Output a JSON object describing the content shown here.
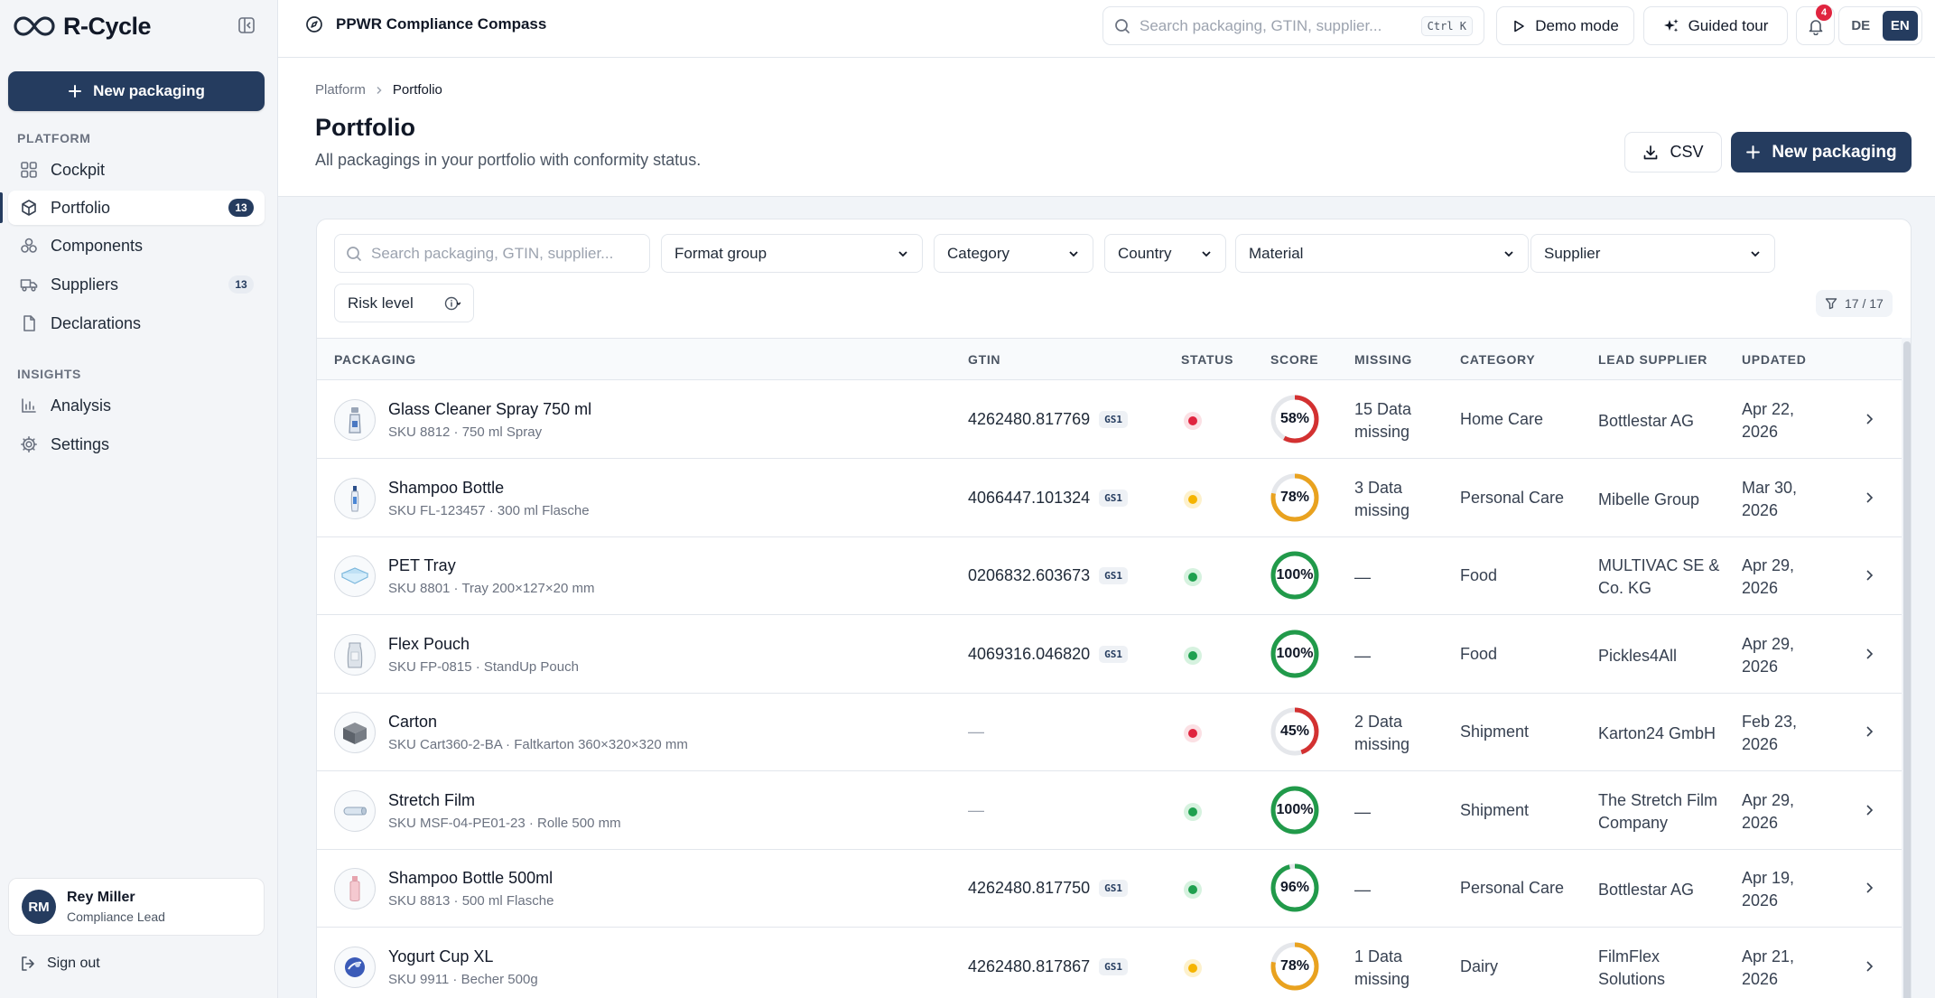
{
  "brand": {
    "name": "R-Cycle"
  },
  "sidebar": {
    "new_button": "New packaging",
    "sections": {
      "platform": "PLATFORM",
      "insights": "INSIGHTS"
    },
    "items": [
      {
        "label": "Cockpit",
        "icon": "grid-icon"
      },
      {
        "label": "Portfolio",
        "icon": "package-icon",
        "count": "13",
        "active": true
      },
      {
        "label": "Components",
        "icon": "components-icon"
      },
      {
        "label": "Suppliers",
        "icon": "truck-icon",
        "count": "13"
      },
      {
        "label": "Declarations",
        "icon": "document-icon"
      },
      {
        "label": "Analysis",
        "icon": "bar-chart-icon"
      },
      {
        "label": "Settings",
        "icon": "gear-icon"
      }
    ],
    "user": {
      "initials": "RM",
      "name": "Rey Miller",
      "role": "Compliance Lead"
    },
    "signout": "Sign out"
  },
  "topbar": {
    "title": "PPWR Compliance Compass",
    "search_placeholder": "Search packaging, GTIN, supplier...",
    "shortcut": "Ctrl K",
    "demo_mode": "Demo mode",
    "guided_tour": "Guided tour",
    "notifications": "4",
    "languages": [
      "DE",
      "EN"
    ],
    "active_language": "EN"
  },
  "page": {
    "breadcrumb": [
      "Platform",
      "Portfolio"
    ],
    "title": "Portfolio",
    "subtitle": "All packagings in your portfolio with conformity status.",
    "csv_button": "CSV",
    "new_button": "New packaging"
  },
  "filters": {
    "search_placeholder": "Search packaging, GTIN, supplier...",
    "format_group": "Format group",
    "category": "Category",
    "country": "Country",
    "material": "Material",
    "supplier": "Supplier",
    "risk_level": "Risk level",
    "result_count": "17 / 17"
  },
  "table": {
    "headers": [
      "PACKAGING",
      "GTIN",
      "STATUS",
      "SCORE",
      "MISSING",
      "CATEGORY",
      "LEAD SUPPLIER",
      "UPDATED"
    ],
    "rows": [
      {
        "name": "Glass Cleaner Spray 750 ml",
        "sku": "SKU 8812 · 750 ml Spray",
        "gtin": "4262480.817769",
        "gs1": "GS1",
        "status": "red",
        "score": 58,
        "score_label": "58%",
        "missing": "15 Data missing",
        "category": "Home Care",
        "supplier": "Bottlestar AG",
        "updated": "Apr 22, 2026",
        "thumb": "spray"
      },
      {
        "name": "Shampoo Bottle",
        "sku": "SKU FL-123457 · 300 ml Flasche",
        "gtin": "4066447.101324",
        "gs1": "GS1",
        "status": "yellow",
        "score": 78,
        "score_label": "78%",
        "missing": "3 Data missing",
        "category": "Personal Care",
        "supplier": "Mibelle Group",
        "updated": "Mar 30, 2026",
        "thumb": "bottle"
      },
      {
        "name": "PET Tray",
        "sku": "SKU 8801 · Tray 200×127×20 mm",
        "gtin": "0206832.603673",
        "gs1": "GS1",
        "status": "green",
        "score": 100,
        "score_label": "100%",
        "missing": "—",
        "category": "Food",
        "supplier": "MULTIVAC SE & Co. KG",
        "updated": "Apr 29, 2026",
        "thumb": "tray"
      },
      {
        "name": "Flex Pouch",
        "sku": "SKU FP-0815 · StandUp Pouch",
        "gtin": "4069316.046820",
        "gs1": "GS1",
        "status": "green",
        "score": 100,
        "score_label": "100%",
        "missing": "—",
        "category": "Food",
        "supplier": "Pickles4All",
        "updated": "Apr 29, 2026",
        "thumb": "pouch"
      },
      {
        "name": "Carton",
        "sku": "SKU Cart360-2-BA · Faltkarton 360×320×320 mm",
        "gtin": "—",
        "gs1": "",
        "status": "red",
        "score": 45,
        "score_label": "45%",
        "missing": "2 Data missing",
        "category": "Shipment",
        "supplier": "Karton24 GmbH",
        "updated": "Feb 23, 2026",
        "thumb": "carton"
      },
      {
        "name": "Stretch Film",
        "sku": "SKU MSF-04-PE01-23 · Rolle 500 mm",
        "gtin": "—",
        "gs1": "",
        "status": "green",
        "score": 100,
        "score_label": "100%",
        "missing": "—",
        "category": "Shipment",
        "supplier": "The Stretch Film Company",
        "updated": "Apr 29, 2026",
        "thumb": "film"
      },
      {
        "name": "Shampoo Bottle 500ml",
        "sku": "SKU 8813 · 500 ml Flasche",
        "gtin": "4262480.817750",
        "gs1": "GS1",
        "status": "green",
        "score": 96,
        "score_label": "96%",
        "missing": "—",
        "category": "Personal Care",
        "supplier": "Bottlestar AG",
        "updated": "Apr 19, 2026",
        "thumb": "pinkbottle"
      },
      {
        "name": "Yogurt Cup XL",
        "sku": "SKU 9911 · Becher 500g",
        "gtin": "4262480.817867",
        "gs1": "GS1",
        "status": "yellow",
        "score": 78,
        "score_label": "78%",
        "missing": "1 Data missing",
        "category": "Dairy",
        "supplier": "FilmFlex Solutions",
        "updated": "Apr 21, 2026",
        "thumb": "cup"
      }
    ]
  },
  "colors": {
    "primary": "#253c5f",
    "red": "#e0243f",
    "yellow": "#f5b400",
    "green": "#1fa04f",
    "score_red": "#d33131",
    "score_orange": "#e9a21f",
    "score_green": "#219a4a"
  }
}
